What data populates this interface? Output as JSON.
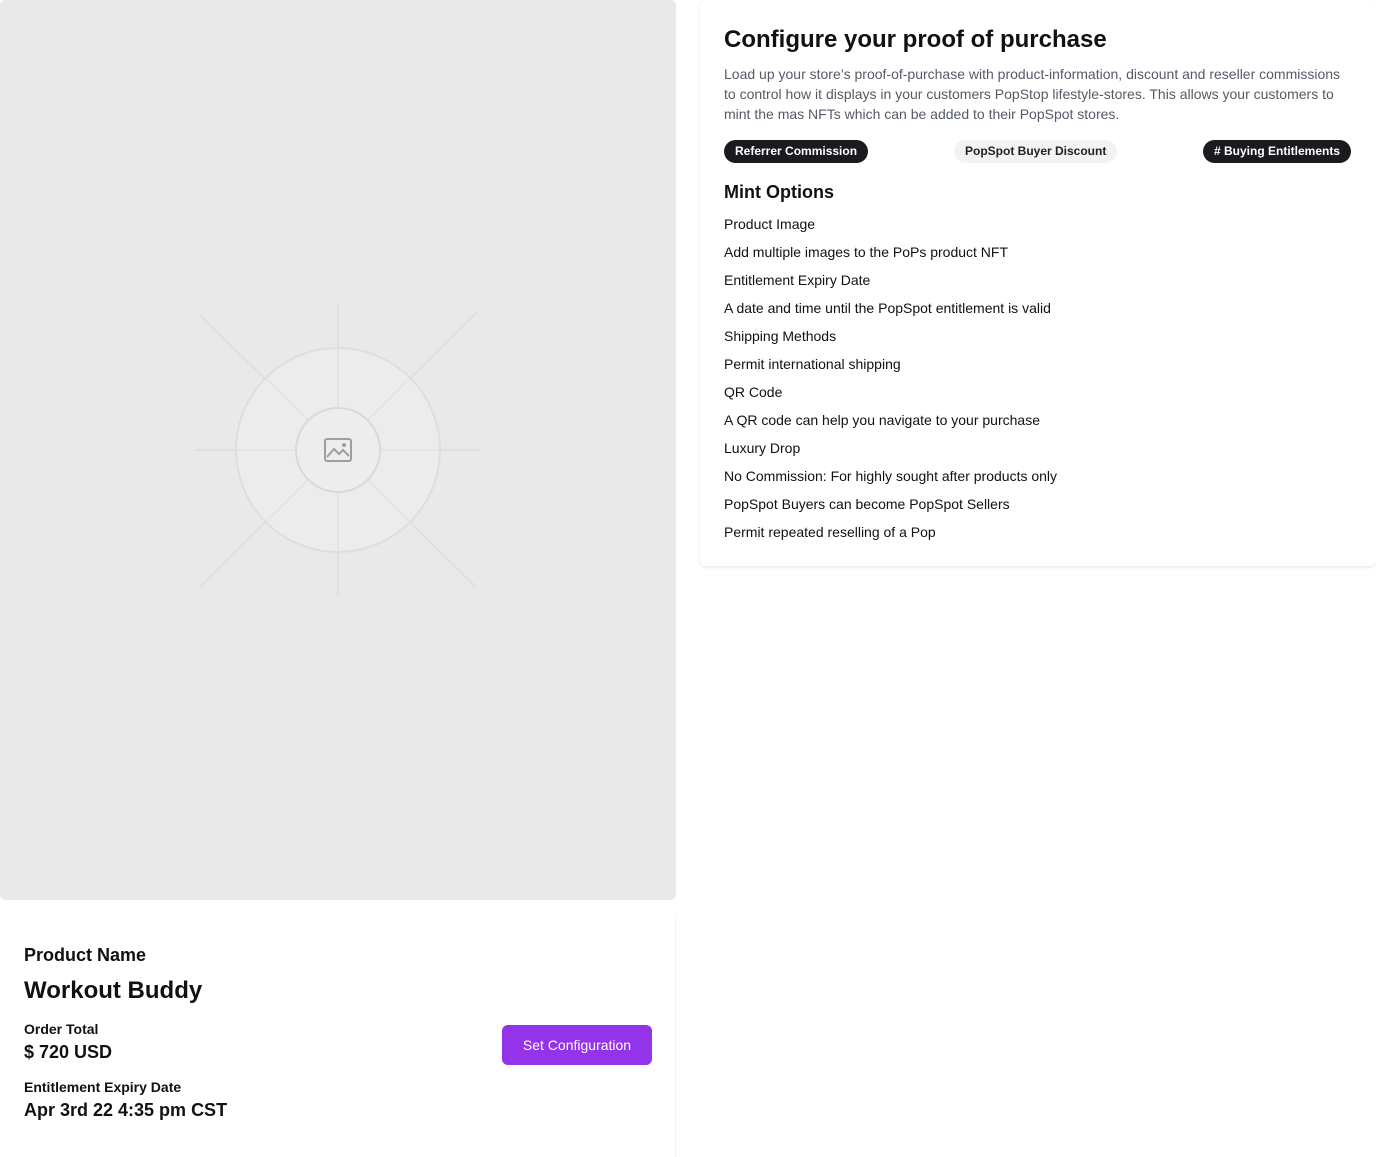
{
  "config": {
    "title": "Configure your proof of purchase",
    "description": "Load up your store’s proof-of-purchase with product-information, discount and reseller commissions to control how it displays in your customers PopStop lifestyle-stores. This allows your customers to mint the mas NFTs which can be added to their PopSpot stores.",
    "tags": [
      {
        "label": "Referrer Commission",
        "style": "dark"
      },
      {
        "label": "PopSpot Buyer Discount",
        "style": "light"
      },
      {
        "label": "# Buying Entitlements",
        "style": "dark"
      }
    ],
    "mint_options_title": "Mint Options",
    "mint_options": [
      "Product Image",
      "Add multiple images to the PoPs product NFT",
      "Entitlement Expiry Date",
      "A date and time until the PopSpot entitlement is valid",
      "Shipping Methods",
      "Permit international shipping",
      "QR Code",
      "A QR code can help you navigate to your purchase",
      "Luxury Drop",
      "No Commission: For highly sought after products only",
      "PopSpot Buyers can become PopSpot Sellers",
      "Permit repeated reselling of a Pop"
    ]
  },
  "product": {
    "name_label": "Product Name",
    "name": "Workout Buddy",
    "order_total_label": "Order Total",
    "order_total": "$ 720 USD",
    "expiry_label": "Entitlement Expiry Date",
    "expiry": "Apr 3rd 22 4:35 pm CST",
    "set_config_button": "Set Configuration"
  },
  "image_placeholder": {
    "icon": "image-icon"
  },
  "colors": {
    "accent": "#9333ea",
    "tag_dark": "#1b1b1f",
    "tag_light": "#f3f3f4",
    "placeholder_bg": "#e9e9e9"
  }
}
